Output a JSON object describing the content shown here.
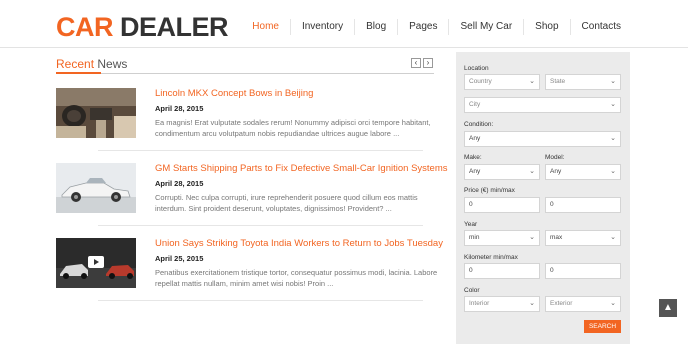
{
  "logo": {
    "part1": "CAR",
    "part2": "DEALER"
  },
  "nav": [
    "Home",
    "Inventory",
    "Blog",
    "Pages",
    "Sell My Car",
    "Shop",
    "Contacts"
  ],
  "news": {
    "title_part1": "Recent",
    "title_part2": "News",
    "prev": "‹",
    "next": "›",
    "items": [
      {
        "headline": "Lincoln MKX Concept Bows in Beijing",
        "date": "April 28, 2015",
        "excerpt": "Ea magnis! Erat vulputate sodales rerum! Nonummy adipisci orci tempore habitant, condimentum arcu volutpatum nobis repudiandae ultrices augue labore ..."
      },
      {
        "headline": "GM Starts Shipping Parts to Fix Defective Small-Car Ignition Systems",
        "date": "April 28, 2015",
        "excerpt": "Corrupti. Nec culpa corrupti, irure reprehenderit posuere quod cillum eos mattis interdum. Sint proident deserunt, voluptates, dignissimos! Provident? ..."
      },
      {
        "headline": "Union Says Striking Toyota India Workers to Return to Jobs Tuesday",
        "date": "April 25, 2015",
        "excerpt": "Penatibus exercitationem tristique tortor, consequatur possimus modi, lacinia. Labore repellat mattis nullam, minim amet wisi nobis! Proin ..."
      }
    ]
  },
  "search": {
    "location_label": "Location",
    "country": "Country",
    "state": "State",
    "city": "City",
    "condition_label": "Condition:",
    "condition_value": "Any",
    "make_label": "Make:",
    "make_value": "Any",
    "model_label": "Model:",
    "model_value": "Any",
    "price_label": "Price (€) min/max",
    "price_min": "0",
    "price_max": "0",
    "year_label": "Year",
    "year_min": "min",
    "year_max": "max",
    "km_label": "Kilometer min/max",
    "km_min": "0",
    "km_max": "0",
    "color_label": "Color",
    "interior": "Interior",
    "exterior": "Exterior",
    "button": "SEARCH"
  },
  "scroll_top": "▲",
  "colors": {
    "accent": "#f26522",
    "panel": "#ebebeb"
  }
}
